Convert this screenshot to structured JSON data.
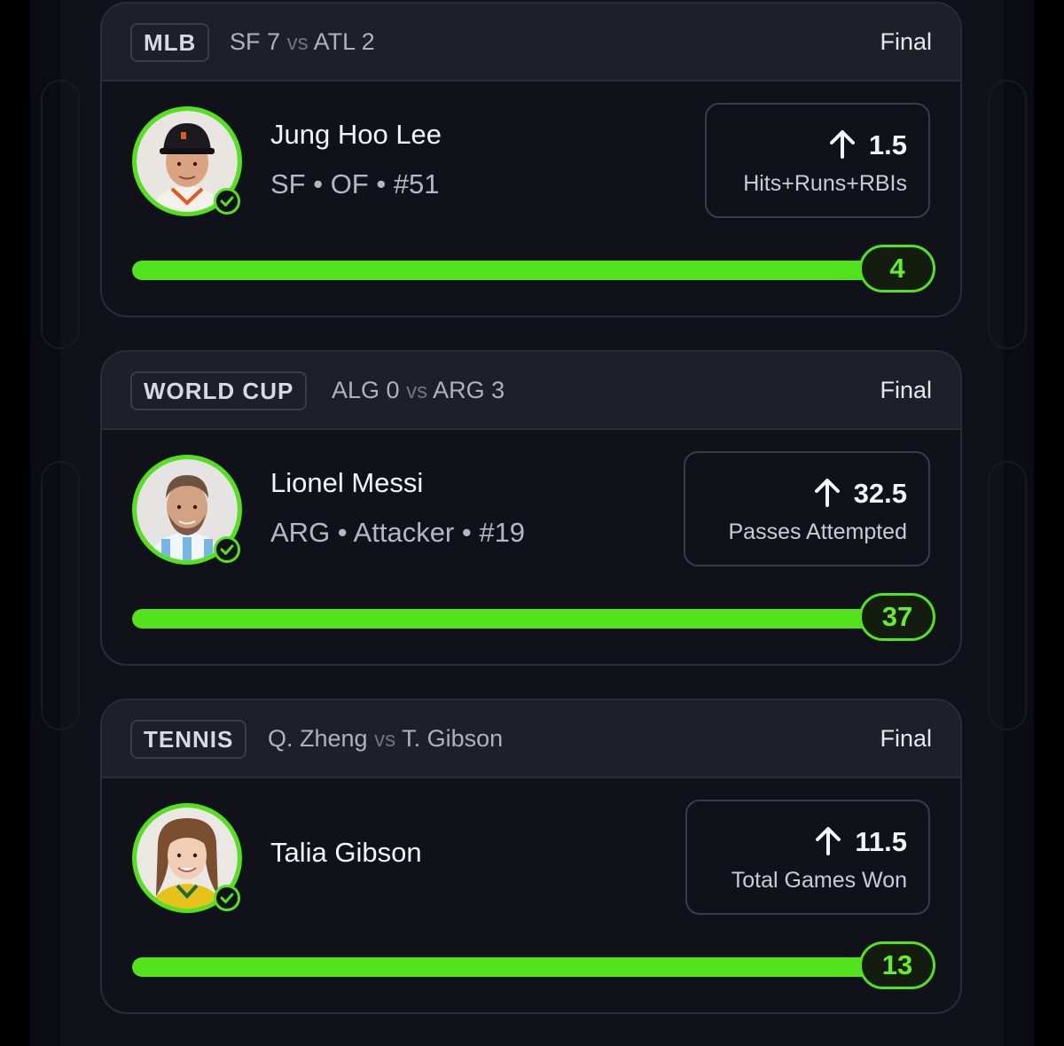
{
  "cards": [
    {
      "league": "MLB",
      "matchup": {
        "team_a": "SF",
        "score_a": "7",
        "vs": "vs",
        "team_b": "ATL",
        "score_b": "2"
      },
      "status": "Final",
      "player": {
        "name": "Jung Hoo Lee",
        "meta": "SF • OF • #51"
      },
      "prop": {
        "direction": "up-arrow-icon",
        "line": "1.5",
        "stat": "Hits+Runs+RBIs"
      },
      "result": {
        "value": "4",
        "progress_fraction": 1.0
      }
    },
    {
      "league": "WORLD CUP",
      "matchup": {
        "team_a": "ALG",
        "score_a": "0",
        "vs": "vs",
        "team_b": "ARG",
        "score_b": "3"
      },
      "status": "Final",
      "player": {
        "name": "Lionel Messi",
        "meta": "ARG • Attacker • #19"
      },
      "prop": {
        "direction": "up-arrow-icon",
        "line": "32.5",
        "stat": "Passes Attempted"
      },
      "result": {
        "value": "37",
        "progress_fraction": 1.0
      }
    },
    {
      "league": "TENNIS",
      "matchup": {
        "team_a": "Q. Zheng",
        "score_a": "",
        "vs": "vs",
        "team_b": "T. Gibson",
        "score_b": ""
      },
      "status": "Final",
      "player": {
        "name": "Talia Gibson",
        "meta": ""
      },
      "prop": {
        "direction": "up-arrow-icon",
        "line": "11.5",
        "stat": "Total Games Won"
      },
      "result": {
        "value": "13",
        "progress_fraction": 1.0
      }
    }
  ],
  "colors": {
    "accent": "#52e31c",
    "card_bg": "#111219",
    "header_bg": "#1d1f29",
    "border": "#2a2d38"
  }
}
